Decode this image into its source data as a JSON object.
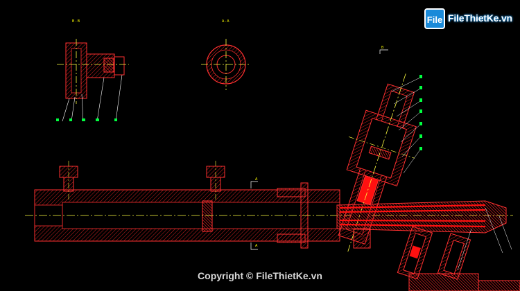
{
  "watermark": {
    "logo_mark": "File",
    "logo_text": "FileThietKe.vn",
    "copyright": "Copyright © FileThietKe.vn"
  },
  "drawing": {
    "section_labels": [
      "B - B",
      "A - A",
      "B",
      "A",
      "A"
    ],
    "colors": {
      "background": "#000000",
      "outline": "#ff3030",
      "hatch": "#cc2020",
      "centerline": "#ffff40",
      "hidden": "#ffffff",
      "leader": "#ffffff",
      "fill": "#ff1010",
      "dim_text": "#ffff00",
      "balloon": "#00ff40"
    }
  }
}
